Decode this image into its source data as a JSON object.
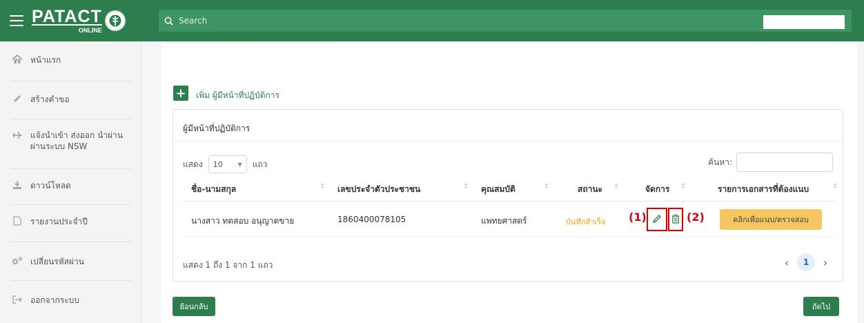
{
  "header": {
    "logo_main": "PATACT",
    "logo_sub": "ONLINE",
    "search_placeholder": "Search"
  },
  "sidebar": {
    "items": [
      {
        "label": "หน้าแรก",
        "icon": "home-icon"
      },
      {
        "label": "สร้างคำขอ",
        "icon": "pencil-icon"
      },
      {
        "label": "แจ้งนำเข้า ส่งออก นำผ่าน ผ่านระบบ NSW",
        "icon": "airplane-icon"
      },
      {
        "label": "ดาวน์โหลด",
        "icon": "download-icon"
      },
      {
        "label": "รายงานประจำปี",
        "icon": "file-icon"
      },
      {
        "label": "เปลี่ยนรหัสผ่าน",
        "icon": "gears-icon"
      },
      {
        "label": "ออกจากระบบ",
        "icon": "sign-out-icon"
      }
    ]
  },
  "main": {
    "add_officer_label": "เพิ่ม ผู้มีหน้าที่ปฏิบัติการ",
    "panel_title": "ผู้มีหน้าที่ปฏิบัติการ",
    "length_prefix": "แสดง",
    "length_value": "10",
    "length_suffix": "แถว",
    "search_label": "ค้นหา:",
    "columns": [
      "ชื่อ-นามสกุล",
      "เลขประจำตัวประชาชน",
      "คุณสมบัติ",
      "สถานะ",
      "จัดการ",
      "รายการเอกสารที่ต้องแนบ"
    ],
    "rows": [
      {
        "name": "นางสาว ทดสอบ อนุญาตขาย",
        "id_number": "1860400078105",
        "qualification": "แพทยศาสตร์",
        "status": "บันทึกสำเร็จ",
        "attach_button": "คลิกเพื่อแนบ/ตรวจสอบ"
      }
    ],
    "annotations": [
      "(1)",
      "(2)"
    ],
    "info": "แสดง 1 ถึง 1 จาก 1 แถว",
    "page": "1",
    "back_button": "ย้อนกลับ",
    "next_button": "ถัดไป"
  },
  "colors": {
    "brand_green": "#2e7d4f",
    "status_orange": "#f0a500",
    "annotation_red": "#d60000",
    "attach_yellow": "#f6c760"
  }
}
